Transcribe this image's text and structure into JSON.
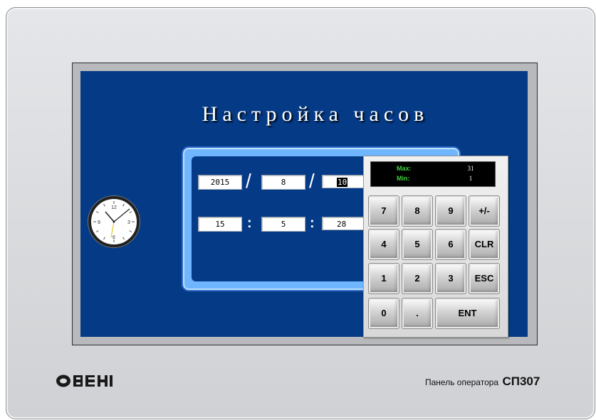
{
  "screen": {
    "title": "Настройка часов",
    "date": {
      "year": "2015",
      "month": "8",
      "day": "10",
      "separator": "/"
    },
    "time": {
      "hours": "15",
      "minutes": "5",
      "seconds": "28",
      "separator": ":"
    }
  },
  "keypad": {
    "max_label": "Max:",
    "max_value": "31",
    "min_label": "Min:",
    "min_value": "1",
    "keys": [
      "7",
      "8",
      "9",
      "+/-",
      "4",
      "5",
      "6",
      "CLR",
      "1",
      "2",
      "3",
      "ESC",
      "0",
      ".",
      "ENT"
    ]
  },
  "device": {
    "brand_logo": "ОВЕН",
    "label_text": "Панель оператора",
    "model": "СП307"
  },
  "colors": {
    "screen_bg": "#053a86",
    "panel_accent": "#6fb6ff",
    "limit_label": "#3bd13b"
  }
}
